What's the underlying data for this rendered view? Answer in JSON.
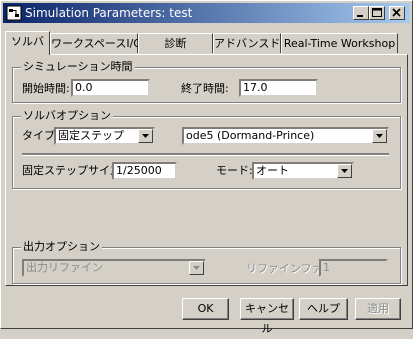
{
  "window": {
    "title": "Simulation Parameters: test",
    "controls": {
      "minimize": "minimize-icon",
      "maximize": "maximize-icon",
      "close": "close-icon"
    }
  },
  "tabs": [
    {
      "label": "ソルバ",
      "active": true
    },
    {
      "label": "ワークスペースI/O",
      "active": false
    },
    {
      "label": "診断",
      "active": false
    },
    {
      "label": "アドバンスド",
      "active": false
    },
    {
      "label": "Real-Time Workshop",
      "active": false
    }
  ],
  "sim_time": {
    "group_label": "シミュレーション時間",
    "start_label": "開始時間:",
    "start_value": "0.0",
    "stop_label": "終了時間:",
    "stop_value": "17.0"
  },
  "solver_options": {
    "group_label": "ソルバオプション",
    "type_label": "タイプ:",
    "type_value": "固定ステップ",
    "solver_value": "ode5 (Dormand-Prince)",
    "step_size_label": "固定ステップサイズ:",
    "step_size_value": "1/25000",
    "mode_label": "モード:",
    "mode_value": "オート"
  },
  "output_options": {
    "group_label": "出力オプション",
    "refine_select_value": "出力リファイン",
    "refine_factor_label": "リファインファクタ:",
    "refine_factor_value": "1"
  },
  "buttons": {
    "ok": "OK",
    "cancel": "キャンセル",
    "help": "ヘルプ",
    "apply": "適用"
  }
}
